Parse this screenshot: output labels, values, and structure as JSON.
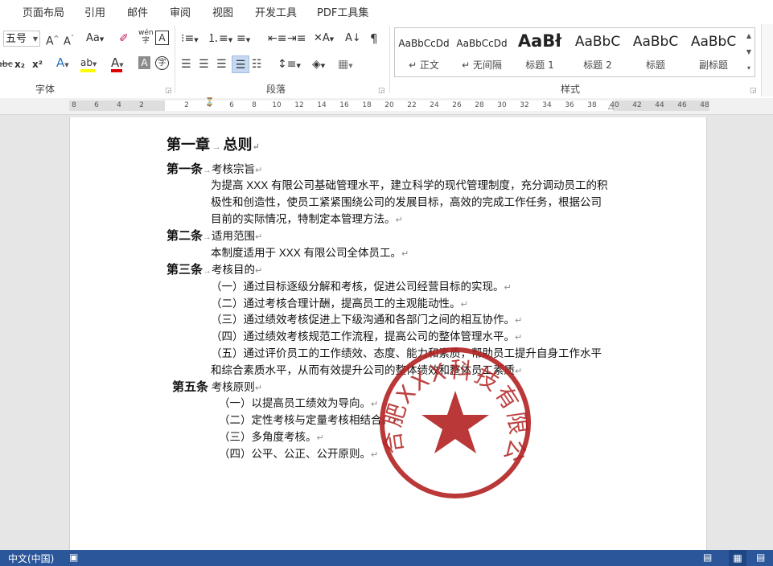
{
  "menu_tabs": [
    "页面布局",
    "引用",
    "邮件",
    "审阅",
    "视图",
    "开发工具",
    "PDF工具集"
  ],
  "font_group": {
    "font_size": "五号",
    "label": "字体",
    "grow_font_icon": "A^",
    "shrink_font_icon": "Aˇ",
    "change_case_label": "Aa",
    "clear_format_icon": "eraser",
    "phonetic_label": "wén",
    "border_char_label": "A",
    "strikethrough_label": "abc",
    "subscript_label": "x₂",
    "superscript_label": "x²",
    "text_effect_label": "A",
    "highlight_label": "ab",
    "font_color_label": "A",
    "char_shading_label": "A",
    "enclose_char_label": "字",
    "highlight_color": "#ffff00",
    "font_color": "#e00000"
  },
  "paragraph_group": {
    "label": "段落",
    "sort_label": "A↓",
    "show_marks_label": "¶"
  },
  "styles_group": {
    "label": "样式",
    "items": [
      {
        "sample": "AaBbCcDd",
        "name": "↵ 正文"
      },
      {
        "sample": "AaBbCcDd",
        "name": "↵ 无间隔"
      },
      {
        "sample": "AaBł",
        "name": "标题 1"
      },
      {
        "sample": "AaBbC",
        "name": "标题 2"
      },
      {
        "sample": "AaBbC",
        "name": "标题"
      },
      {
        "sample": "AaBbC",
        "name": "副标题"
      }
    ]
  },
  "ruler": {
    "ticks": [
      "8",
      "6",
      "4",
      "2",
      "",
      "2",
      "4",
      "6",
      "8",
      "10",
      "12",
      "14",
      "16",
      "18",
      "20",
      "22",
      "24",
      "26",
      "28",
      "30",
      "32",
      "34",
      "36",
      "38",
      "40",
      "42",
      "44",
      "46",
      "48"
    ]
  },
  "document": {
    "chapter": {
      "num": "第一章",
      "title": "总则"
    },
    "articles": [
      {
        "num": "第一条",
        "title": "考核宗旨",
        "body": [
          "为提高 XXX 有限公司基础管理水平，建立科学的现代管理制度，充分调动员工的积",
          "极性和创造性，使员工紧紧围绕公司的发展目标，高效的完成工作任务，根据公司",
          "目前的实际情况，特制定本管理方法。"
        ]
      },
      {
        "num": "第二条",
        "title": "适用范围",
        "body": [
          "本制度适用于 XXX 有限公司全体员工。"
        ]
      },
      {
        "num": "第三条",
        "title": "考核目的",
        "body": [
          "（一）通过目标逐级分解和考核，促进公司经营目标的实现。",
          "（二）通过考核合理计酬，提高员工的主观能动性。",
          "（三）通过绩效考核促进上下级沟通和各部门之间的相互协作。",
          "（四）通过绩效考核规范工作流程，提高公司的整体管理水平。",
          "（五）通过评价员工的工作绩效、态度、能力和素质，帮助员工提升自身工作水平",
          "和综合素质水平，从而有效提升公司的整体绩效和整体员工素质"
        ]
      },
      {
        "num": "第五条",
        "title": "考核原则",
        "body": [
          "（一）以提高员工绩效为导向。",
          "（二）定性考核与定量考核相结合。",
          "（三）多角度考核。",
          "（四）公平、公正、公开原则。"
        ]
      }
    ],
    "stamp": {
      "text": "合肥XXX科技有限公司",
      "color": "#b22222"
    }
  },
  "status_bar": {
    "language": "中文(中国)",
    "bg_color": "#2b579a"
  },
  "icons": [
    "paste-area",
    "grow-font-icon",
    "shrink-font-icon",
    "clear-format-icon",
    "bullets-icon",
    "numbering-icon",
    "multilevel-list-icon",
    "decrease-indent-icon",
    "increase-indent-icon",
    "align-left-icon",
    "center-icon",
    "align-right-icon",
    "justify-icon",
    "distributed-icon",
    "line-spacing-icon",
    "shading-icon",
    "borders-icon",
    "read-mode-icon",
    "print-layout-icon",
    "web-layout-icon"
  ]
}
